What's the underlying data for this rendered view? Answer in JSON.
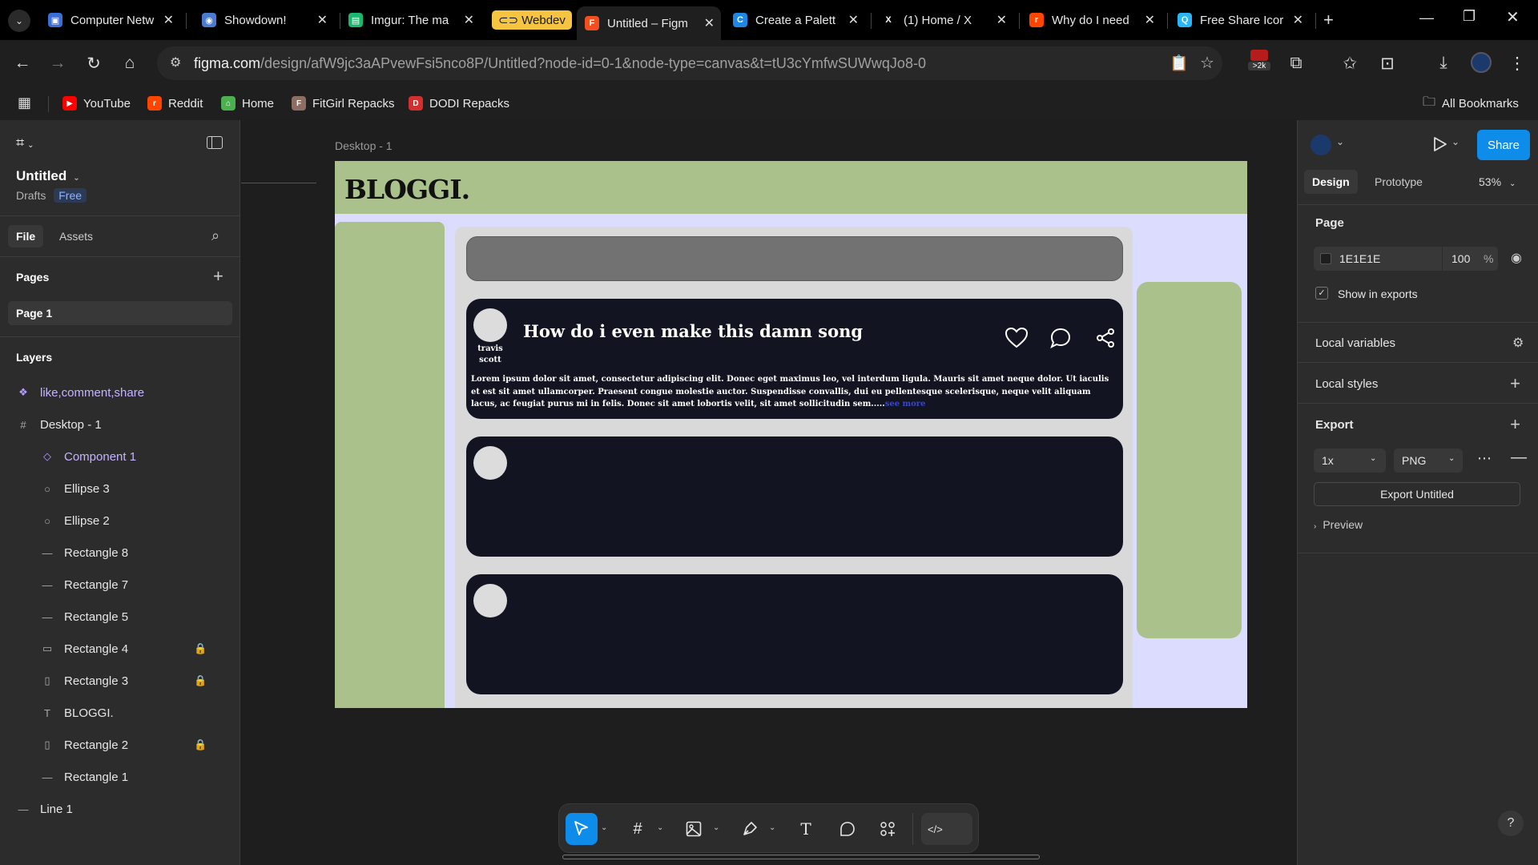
{
  "browser": {
    "tabs": [
      {
        "title": "Computer Netw",
        "color": "#3b6fd8",
        "glyph": "▣"
      },
      {
        "title": "Showdown!",
        "color": "#4a7bd0",
        "glyph": "◉"
      },
      {
        "title": "Imgur: The ma",
        "color": "#1bb76e",
        "glyph": "▤"
      },
      {
        "title": "Untitled – Figm",
        "color": "#f24e1e",
        "glyph": "F"
      },
      {
        "title": "Create a Palett",
        "color": "#1e88e5",
        "glyph": "C"
      },
      {
        "title": "(1) Home / X",
        "color": "#000000",
        "glyph": "X"
      },
      {
        "title": "Why do I need",
        "color": "#ff4500",
        "glyph": "r"
      },
      {
        "title": "Free Share Icor",
        "color": "#29b6f6",
        "glyph": "Q"
      }
    ],
    "tab_group_label": "Webdev",
    "url_host": "figma.com",
    "url_path": "/design/afW9jc3aAPvewFsi5nco8P/Untitled?node-id=0-1&node-type=canvas&t=tU3cYmfwSUWwqJo8-0",
    "extension_badge": ">2k",
    "bookmarks": [
      {
        "label": "YouTube",
        "color": "#ff0000",
        "glyph": "▶"
      },
      {
        "label": "Reddit",
        "color": "#ff4500",
        "glyph": "r"
      },
      {
        "label": "Home",
        "color": "#4caf50",
        "glyph": "⌂"
      },
      {
        "label": "FitGirl Repacks",
        "color": "#8d6e63",
        "glyph": "F"
      },
      {
        "label": "DODI Repacks",
        "color": "#d32f2f",
        "glyph": "D"
      }
    ],
    "all_bookmarks": "All Bookmarks"
  },
  "figma": {
    "file_name": "Untitled",
    "location": "Drafts",
    "plan_badge": "Free",
    "left_tabs": {
      "file": "File",
      "assets": "Assets"
    },
    "pages_heading": "Pages",
    "pages": [
      "Page 1"
    ],
    "layers_heading": "Layers",
    "layers": [
      {
        "name": "like,comment,share",
        "icon": "component-icon",
        "glyph": "❖",
        "indent": 0,
        "locked": false,
        "highlight": true
      },
      {
        "name": "Desktop - 1",
        "icon": "frame-icon",
        "glyph": "#",
        "indent": 0,
        "locked": false,
        "highlight": false
      },
      {
        "name": "Component 1",
        "icon": "instance-icon",
        "glyph": "◇",
        "indent": 1,
        "locked": false,
        "highlight": false
      },
      {
        "name": "Ellipse 3",
        "icon": "ellipse-icon",
        "glyph": "○",
        "indent": 1,
        "locked": false,
        "highlight": false
      },
      {
        "name": "Ellipse 2",
        "icon": "ellipse-icon",
        "glyph": "○",
        "indent": 1,
        "locked": false,
        "highlight": false
      },
      {
        "name": "Rectangle 8",
        "icon": "line-icon",
        "glyph": "—",
        "indent": 1,
        "locked": false,
        "highlight": false
      },
      {
        "name": "Rectangle 7",
        "icon": "line-icon",
        "glyph": "—",
        "indent": 1,
        "locked": false,
        "highlight": false
      },
      {
        "name": "Rectangle 5",
        "icon": "line-icon",
        "glyph": "—",
        "indent": 1,
        "locked": false,
        "highlight": false
      },
      {
        "name": "Rectangle 4",
        "icon": "rectangle-icon",
        "glyph": "▭",
        "indent": 1,
        "locked": true,
        "highlight": false
      },
      {
        "name": "Rectangle 3",
        "icon": "rectangle-icon",
        "glyph": "▯",
        "indent": 1,
        "locked": true,
        "highlight": false
      },
      {
        "name": "BLOGGI.",
        "icon": "text-icon",
        "glyph": "T",
        "indent": 1,
        "locked": false,
        "highlight": false
      },
      {
        "name": "Rectangle 2",
        "icon": "rectangle-icon",
        "glyph": "▯",
        "indent": 1,
        "locked": true,
        "highlight": false
      },
      {
        "name": "Rectangle 1",
        "icon": "line-icon",
        "glyph": "—",
        "indent": 1,
        "locked": false,
        "highlight": false
      },
      {
        "name": "Line 1",
        "icon": "line-icon",
        "glyph": "—",
        "indent": 0,
        "locked": false,
        "highlight": false
      }
    ],
    "canvas": {
      "frame_label": "Desktop - 1",
      "logo": "BLOGGI.",
      "post_title": "How do i even make this damn song",
      "author": "travis scott",
      "post_body": "Lorem ipsum dolor sit amet, consectetur adipiscing elit. Donec eget maximus leo, vel interdum ligula. Mauris sit amet neque dolor. Ut iaculis et est sit amet ullamcorper. Praesent congue molestie auctor. Suspendisse convallis, dui eu pellentesque scelerisque, neque velit aliquam lacus, ac feugiat purus mi in felis. Donec sit amet lobortis velit, sit amet sollicitudin sem.....",
      "see_more": "see more",
      "colors": {
        "header": "#abc18c",
        "frame_bg": "#dcdcff",
        "feed_bg": "#d9d9d9",
        "post_bg": "#121421",
        "search_bar": "#727272"
      }
    },
    "right": {
      "tabs": {
        "design": "Design",
        "prototype": "Prototype"
      },
      "zoom": "53%",
      "share": "Share",
      "page_heading": "Page",
      "page_color": "1E1E1E",
      "page_opacity": "100",
      "percent": "%",
      "show_in_exports": "Show in exports",
      "local_variables": "Local variables",
      "local_styles": "Local styles",
      "export_heading": "Export",
      "export_scale": "1x",
      "export_format": "PNG",
      "export_button": "Export Untitled",
      "preview": "Preview",
      "help": "?"
    }
  }
}
